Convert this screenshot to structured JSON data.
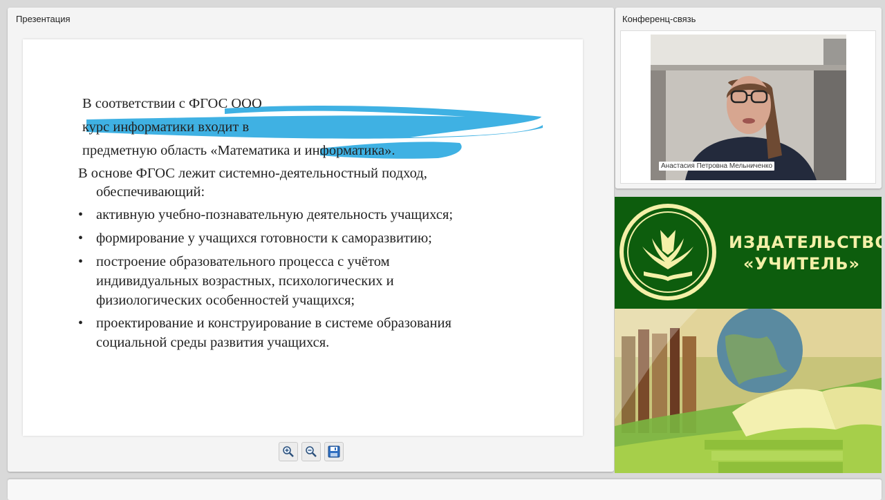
{
  "presentation": {
    "title": "Презентация",
    "slide": {
      "lines": [
        "В соответствии с ФГОС ООО",
        "курс информатики входит в",
        "предметную область «Математика и информатика».",
        "В основе ФГОС лежит системно-деятельностный подход,",
        "обеспечивающий:"
      ],
      "bullets": [
        "активную учебно-познавательную деятельность учащихся;",
        "формирование у учащихся готовности к саморазвитию;",
        "построение образовательного процесса с учётом индивидуальных возрастных, психологических и физиологических особенностей учащихся;",
        "проектирование и конструирование в системе образования социальной среды развития  учащихся."
      ],
      "bullet_symbol": "•",
      "highlight_color": "#2aa8e0"
    },
    "toolbar": {
      "zoom_in_icon": "zoom-in-icon",
      "zoom_out_icon": "zoom-out-icon",
      "save_icon": "save-icon"
    }
  },
  "conference": {
    "title": "Конференц-связь",
    "participant_name": "Анастасия Петровна Мельниченко"
  },
  "banner": {
    "line1": "ИЗДАТЕЛЬСТВО",
    "line2": "«УЧИТЕЛЬ»",
    "brand_green": "#0d5d0d",
    "brand_text": "#f4f0a8"
  }
}
